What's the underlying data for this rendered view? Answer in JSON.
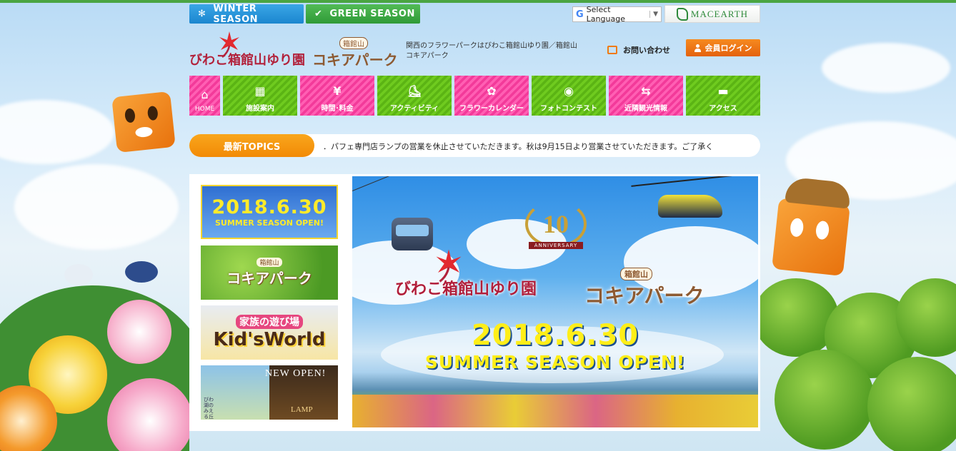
{
  "season_tabs": {
    "winter": "WINTER SEASON",
    "green": "GREEN SEASON"
  },
  "language": {
    "label": "Select Language",
    "arrow": "▼"
  },
  "macearth": "MACEARTH",
  "logos": {
    "yuri": "びわこ箱館山ゆり園",
    "kokia_sub": "箱館山",
    "kokia_main": "コキアパーク"
  },
  "header": {
    "description": "関西のフラワーパークはびわこ箱館山ゆり園／箱館山コキアパーク",
    "contact": "お問い合わせ",
    "login": "会員ログイン"
  },
  "nav": [
    {
      "label": "HOME",
      "icon": "home-icon",
      "glyph": "⌂"
    },
    {
      "label": "施設案内",
      "icon": "building-icon",
      "glyph": "▦"
    },
    {
      "label": "時間･料金",
      "icon": "yen-icon",
      "glyph": "¥"
    },
    {
      "label": "アクティビティ",
      "icon": "shoe-icon",
      "glyph": "⛸"
    },
    {
      "label": "フラワーカレンダー",
      "icon": "flower-icon",
      "glyph": "✿"
    },
    {
      "label": "フォトコンテスト",
      "icon": "camera-icon",
      "glyph": "◉"
    },
    {
      "label": "近隣観光情報",
      "icon": "signpost-icon",
      "glyph": "⇆"
    },
    {
      "label": "アクセス",
      "icon": "car-icon",
      "glyph": "▬"
    }
  ],
  "topics": {
    "label": "最新TOPICS",
    "text": "．パフェ専門店ランプの営業を休止させていただきます。秋は9月15日より営業させていただきます。ご了承く"
  },
  "banners": {
    "summer": {
      "date": "2018.6.30",
      "caption": "SUMMER SEASON OPEN!"
    },
    "kokia": {
      "sub": "箱館山",
      "main": "コキアパーク"
    },
    "kids": {
      "sub": "家族の遊び場",
      "main": "Kid'sWorld"
    },
    "newopen": {
      "label": "NEW OPEN!",
      "caption": "びわ湖のみえる丘",
      "lamp": "LAMP"
    }
  },
  "hero": {
    "anniversary_number": "10",
    "anniversary_label": "ANNIVERSARY",
    "yuri": "びわこ箱館山ゆり園",
    "kokia_sub": "箱館山",
    "kokia": "コキアパーク",
    "date": "2018.6.30",
    "open": "SUMMER SEASON OPEN!"
  },
  "colors": {
    "accent_orange": "#f28a06",
    "nav_pink": "#f33a9a",
    "nav_green": "#5bb414",
    "winter_blue": "#1b86cf",
    "green_season": "#2f9a37"
  }
}
